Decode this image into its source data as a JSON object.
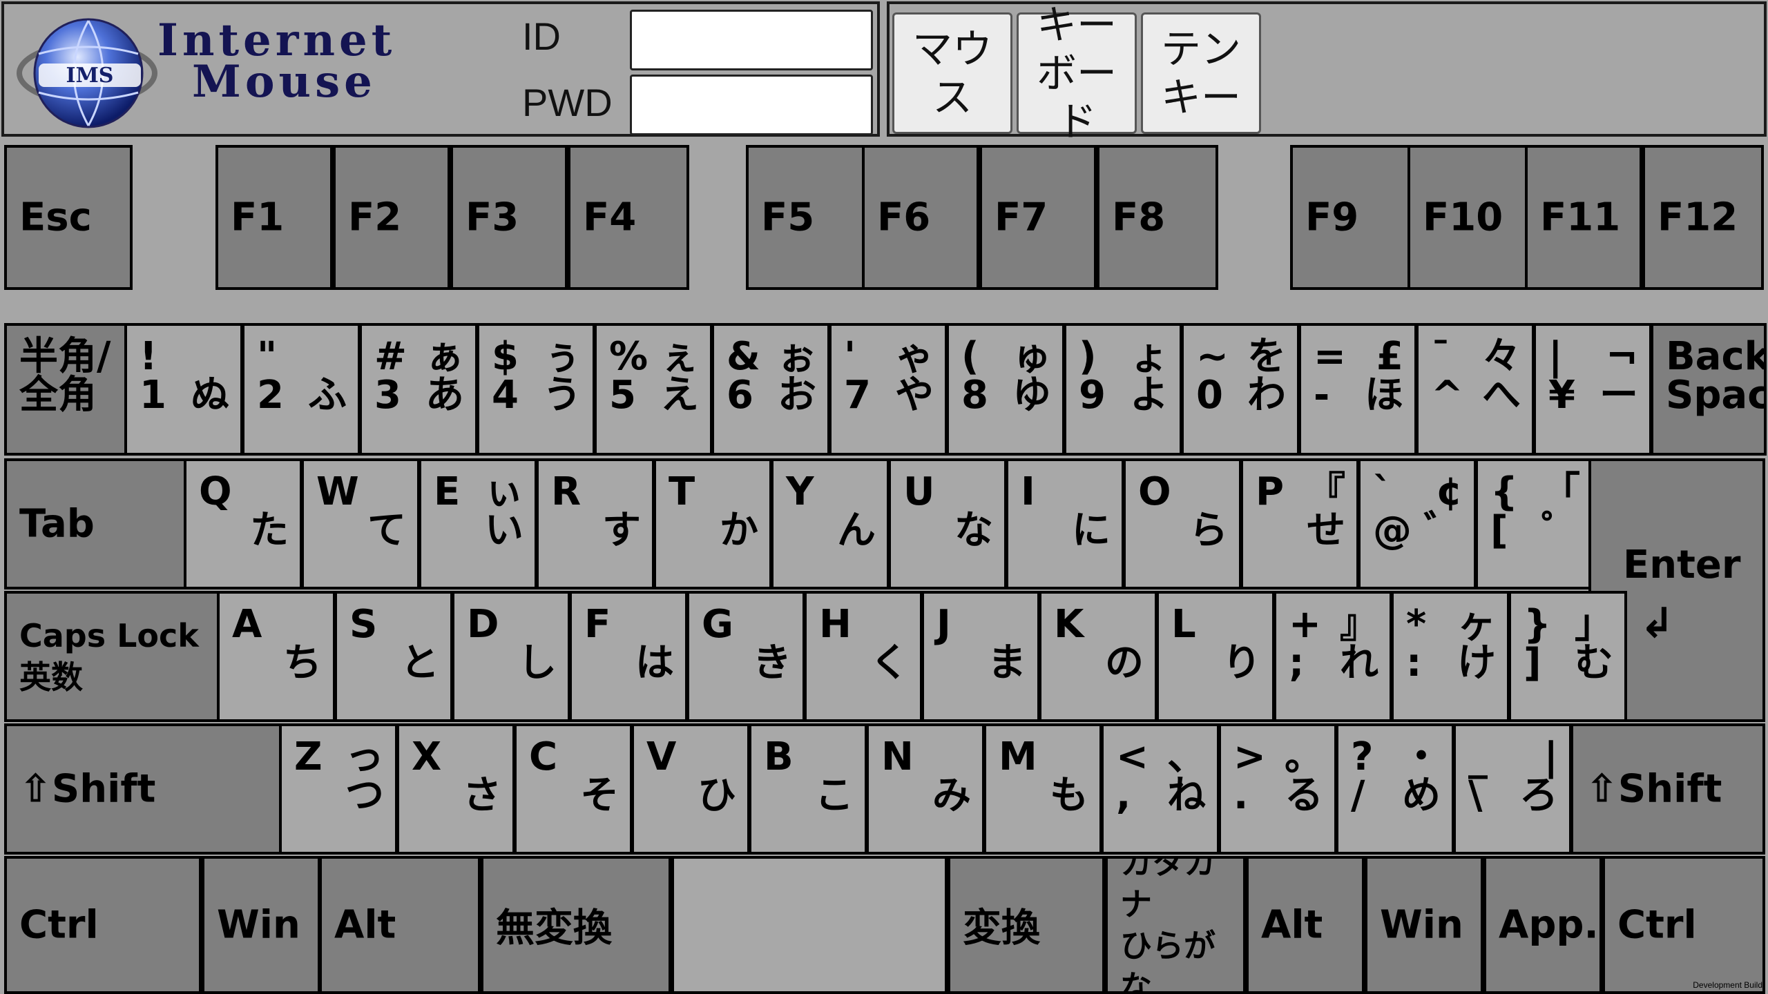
{
  "login": {
    "id_label": "ID",
    "pwd_label": "PWD",
    "id_value": "",
    "pwd_value": ""
  },
  "logo": {
    "line1": "Internet",
    "line2": "Mouse",
    "badge": "IMS"
  },
  "modes": [
    {
      "label": "マウス"
    },
    {
      "label": "キー\nボード"
    },
    {
      "label": "テン\nキー"
    }
  ],
  "keyboard": {
    "frow": [
      "Esc",
      "F1",
      "F2",
      "F3",
      "F4",
      "F5",
      "F6",
      "F7",
      "F8",
      "F9",
      "F10",
      "F11",
      "F12"
    ],
    "num": [
      {
        "tl": "半角/",
        "bl": "全角"
      },
      {
        "tl": "!",
        "bl": "1",
        "br": "ぬ"
      },
      {
        "tl": "\"",
        "bl": "2",
        "br": "ふ"
      },
      {
        "tl": "#",
        "tr": "ぁ",
        "bl": "3",
        "br": "あ"
      },
      {
        "tl": "$",
        "tr": "ぅ",
        "bl": "4",
        "br": "う"
      },
      {
        "tl": "%",
        "tr": "ぇ",
        "bl": "5",
        "br": "え"
      },
      {
        "tl": "&",
        "tr": "ぉ",
        "bl": "6",
        "br": "お"
      },
      {
        "tl": "'",
        "tr": "ゃ",
        "bl": "7",
        "br": "や"
      },
      {
        "tl": "(",
        "tr": "ゅ",
        "bl": "8",
        "br": "ゆ"
      },
      {
        "tl": ")",
        "tr": "ょ",
        "bl": "9",
        "br": "よ"
      },
      {
        "tl": "~",
        "tr": "を",
        "bl": "0",
        "br": "わ"
      },
      {
        "tl": "=",
        "tr": "£",
        "bl": "-",
        "br": "ほ"
      },
      {
        "tl": "¯",
        "tr": "々",
        "bl": "^",
        "br": "へ"
      },
      {
        "tl": "|",
        "tr": "¬",
        "bl": "¥",
        "br": "ー"
      },
      {
        "tl": "Back",
        "bl": "Space"
      }
    ],
    "q": [
      {
        "label": "Tab"
      },
      {
        "tl": "Q",
        "br": "た"
      },
      {
        "tl": "W",
        "br": "て"
      },
      {
        "tl": "E",
        "tr": "ぃ",
        "br": "い"
      },
      {
        "tl": "R",
        "br": "す"
      },
      {
        "tl": "T",
        "br": "か"
      },
      {
        "tl": "Y",
        "br": "ん"
      },
      {
        "tl": "U",
        "br": "な"
      },
      {
        "tl": "I",
        "br": "に"
      },
      {
        "tl": "O",
        "br": "ら"
      },
      {
        "tl": "P",
        "tr": "『",
        "br": "せ"
      },
      {
        "tl": "`",
        "tr": "¢",
        "bl": "@",
        "br": "゛"
      },
      {
        "tl": "{",
        "tr": "「",
        "bl": "[",
        "br": "゜"
      }
    ],
    "enter": {
      "label": "Enter",
      "icon": "↲"
    },
    "a": [
      {
        "label": "Caps Lock\n英数"
      },
      {
        "tl": "A",
        "br": "ち"
      },
      {
        "tl": "S",
        "br": "と"
      },
      {
        "tl": "D",
        "br": "し"
      },
      {
        "tl": "F",
        "br": "は"
      },
      {
        "tl": "G",
        "br": "き"
      },
      {
        "tl": "H",
        "br": "く"
      },
      {
        "tl": "J",
        "br": "ま"
      },
      {
        "tl": "K",
        "br": "の"
      },
      {
        "tl": "L",
        "br": "り"
      },
      {
        "tl": "+",
        "tr": "』",
        "bl": ";",
        "br": "れ"
      },
      {
        "tl": "*",
        "tr": "ヶ",
        "bl": ":",
        "br": "け"
      },
      {
        "tl": "}",
        "tr": "」",
        "bl": "]",
        "br": "む"
      }
    ],
    "z": [
      {
        "label": "⇧Shift"
      },
      {
        "tl": "Z",
        "tr": "っ",
        "br": "つ"
      },
      {
        "tl": "X",
        "br": "さ"
      },
      {
        "tl": "C",
        "br": "そ"
      },
      {
        "tl": "V",
        "br": "ひ"
      },
      {
        "tl": "B",
        "br": "こ"
      },
      {
        "tl": "N",
        "br": "み"
      },
      {
        "tl": "M",
        "br": "も"
      },
      {
        "tl": "<",
        "tr": "、",
        "bl": ",",
        "br": "ね"
      },
      {
        "tl": ">",
        "tr": "。",
        "bl": ".",
        "br": "る"
      },
      {
        "tl": "?",
        "tr": "・",
        "bl": "/",
        "br": "め"
      },
      {
        "tl": "_",
        "tr": "|",
        "bl": "\\",
        "br": "ろ"
      },
      {
        "label": "⇧Shift"
      }
    ],
    "bottom": [
      "Ctrl",
      "Win",
      "Alt",
      "無変換",
      "",
      "変換",
      "カタカナ\nひらがな",
      "Alt",
      "Win",
      "App.",
      "Ctrl"
    ]
  },
  "footer": {
    "devbuild": "Development Build"
  }
}
